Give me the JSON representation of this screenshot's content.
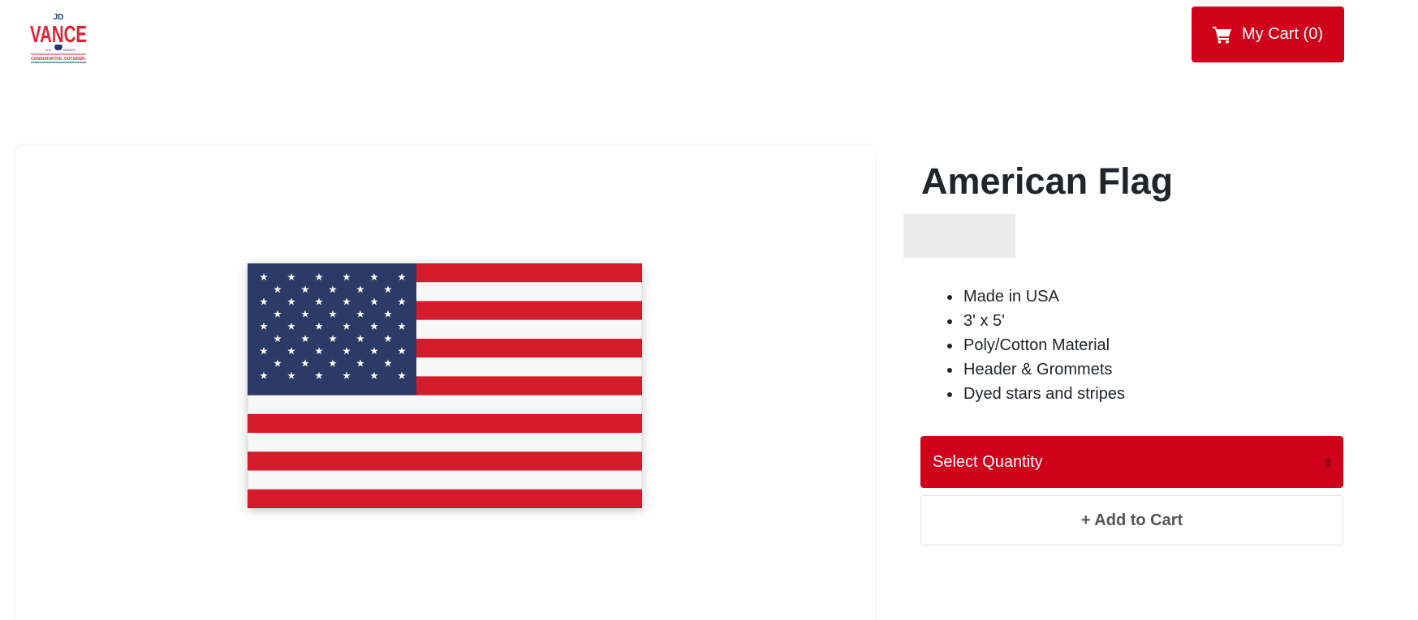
{
  "header": {
    "logo": {
      "small_text": "JD",
      "name": "VANCE",
      "office_left": "U.S.",
      "office_right": "SENATE",
      "tagline": "CONSERVATIVE. OUTSIDER.",
      "icon": "ohio-state-icon"
    },
    "cart": {
      "label": "My Cart (0)",
      "icon": "shopping-cart-icon"
    }
  },
  "product": {
    "title": "American Flag",
    "image_alt": "American flag",
    "features": [
      "Made in USA",
      "3' x 5'",
      "Poly/Cotton Material",
      "Header & Grommets",
      "Dyed stars and stripes"
    ],
    "quantity_select": {
      "label": "Select Quantity",
      "icon": "sort-arrows-icon"
    },
    "add_to_cart_label": "+ Add to Cart"
  },
  "colors": {
    "brand_red": "#d0021b",
    "logo_navy": "#1f3a6e",
    "flag_blue": "#2b3a67",
    "flag_red": "#d41b2c"
  }
}
